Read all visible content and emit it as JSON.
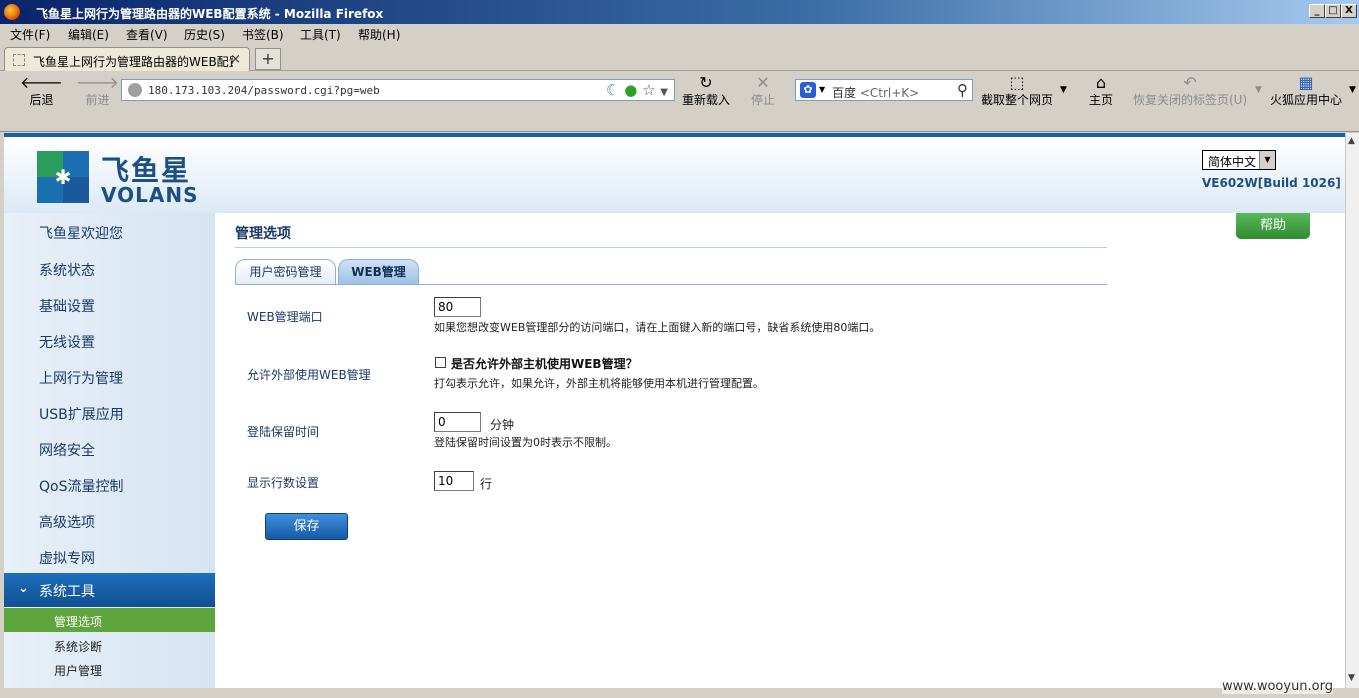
{
  "window": {
    "title": "飞鱼星上网行为管理路由器的WEB配置系统 - Mozilla Firefox",
    "min": "_",
    "max": "□",
    "close": "X"
  },
  "menu": [
    "文件(F)",
    "编辑(E)",
    "查看(V)",
    "历史(S)",
    "书签(B)",
    "工具(T)",
    "帮助(H)"
  ],
  "tab": {
    "label": "飞鱼星上网行为管理路由器的WEB配置…",
    "close": "×",
    "new": "+"
  },
  "nav": {
    "back": "后退",
    "forward": "前进",
    "url": "180.173.103.204/password.cgi?pg=web",
    "reload": "重新载入",
    "stop": "停止",
    "search_engine": "百度",
    "search_placeholder": "<Ctrl+K>",
    "capture": "截取整个网页",
    "home": "主页",
    "restore_tabs": "恢复关闭的标签页(U)",
    "app_center": "火狐应用中心"
  },
  "header": {
    "logo_cn": "飞鱼星",
    "logo_en": "VOLANS",
    "language": "简体中文",
    "build": "VE602W[Build 1026]",
    "help": "帮助"
  },
  "sidebar": {
    "items": [
      "飞鱼星欢迎您",
      "系统状态",
      "基础设置",
      "无线设置",
      "上网行为管理",
      "USB扩展应用",
      "网络安全",
      "QoS流量控制",
      "高级选项",
      "虚拟专网"
    ],
    "active_section": "系统工具",
    "active_sub": "管理选项",
    "subs": [
      "系统诊断",
      "用户管理"
    ]
  },
  "main": {
    "title": "管理选项",
    "tabs": [
      "用户密码管理",
      "WEB管理"
    ],
    "port_label": "WEB管理端口",
    "port_value": "80",
    "port_hint": "如果您想改变WEB管理部分的访问端口，请在上面键入新的端口号，缺省系统使用80端口。",
    "remote_label": "允许外部使用WEB管理",
    "remote_checkbox_label": "是否允许外部主机使用WEB管理？",
    "remote_checked": false,
    "remote_hint": "打勾表示允许，如果允许，外部主机将能够使用本机进行管理配置。",
    "login_label": "登陆保留时间",
    "login_value": "0",
    "login_unit": "分钟",
    "login_hint": "登陆保留时间设置为0时表示不限制。",
    "rows_label": "显示行数设置",
    "rows_value": "10",
    "rows_unit": "行",
    "save": "保存"
  },
  "watermark": "www.wooyun.org"
}
